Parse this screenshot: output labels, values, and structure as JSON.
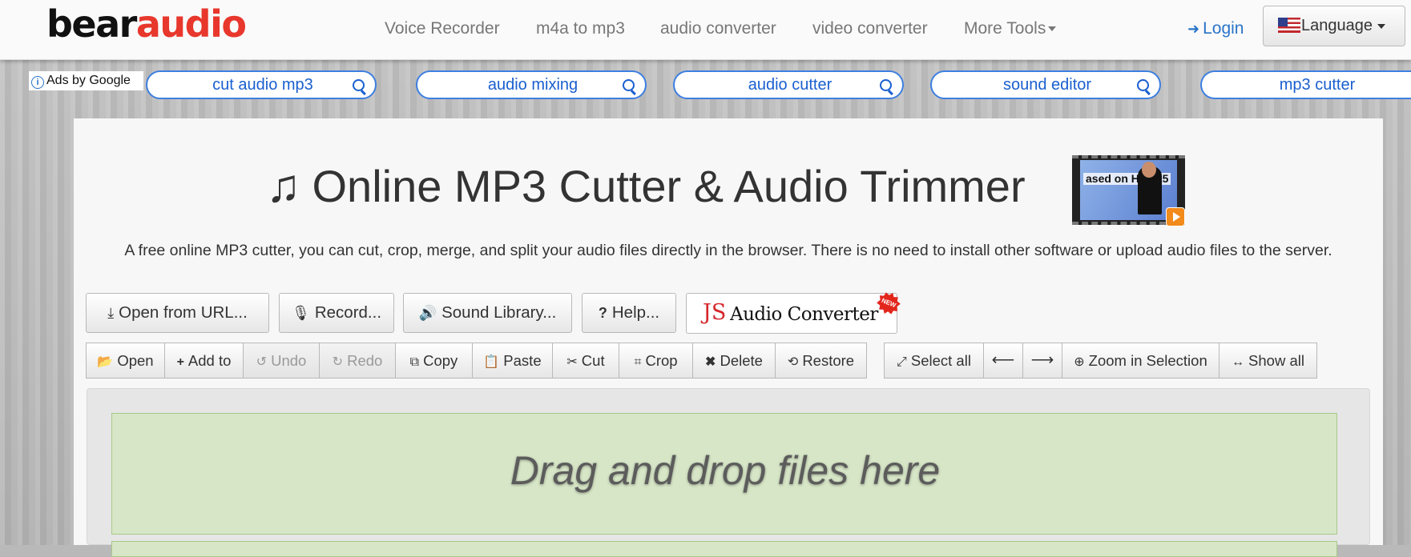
{
  "header": {
    "logo": {
      "part1": "bear",
      "part2": "audio"
    },
    "nav": [
      "Voice Recorder",
      "m4a to mp3",
      "audio converter",
      "video converter",
      "More Tools"
    ],
    "login": "Login",
    "language": "Language"
  },
  "ads": {
    "label": "Ads by Google",
    "items": [
      "cut audio mp3",
      "audio mixing",
      "audio cutter",
      "sound editor",
      "mp3 cutter"
    ]
  },
  "main": {
    "title": "Online MP3 Cutter & Audio Trimmer",
    "video_thumb_text": "ased on HTML5",
    "subtitle": "A free online MP3 cutter, you can cut, crop, merge, and split your audio files directly in the browser. There is no need to install other software or upload audio files to the server.",
    "actions": [
      "Open from URL...",
      "Record...",
      "Sound Library...",
      "Help..."
    ],
    "js_converter": {
      "js": "JS",
      "label": "Audio Converter",
      "badge": "NEW"
    },
    "toolbar": [
      "Open",
      "Add to",
      "Undo",
      "Redo",
      "Copy",
      "Paste",
      "Cut",
      "Crop",
      "Delete",
      "Restore"
    ],
    "toolbar2": [
      "Select all",
      "Zoom in Selection",
      "Show all"
    ],
    "dropzone": "Drag and drop files here"
  },
  "colors": {
    "brand_red": "#e8372c",
    "link_blue": "#2a74c8",
    "ad_blue": "#1a5fd0",
    "dropzone_green": "#d7e6c7"
  }
}
